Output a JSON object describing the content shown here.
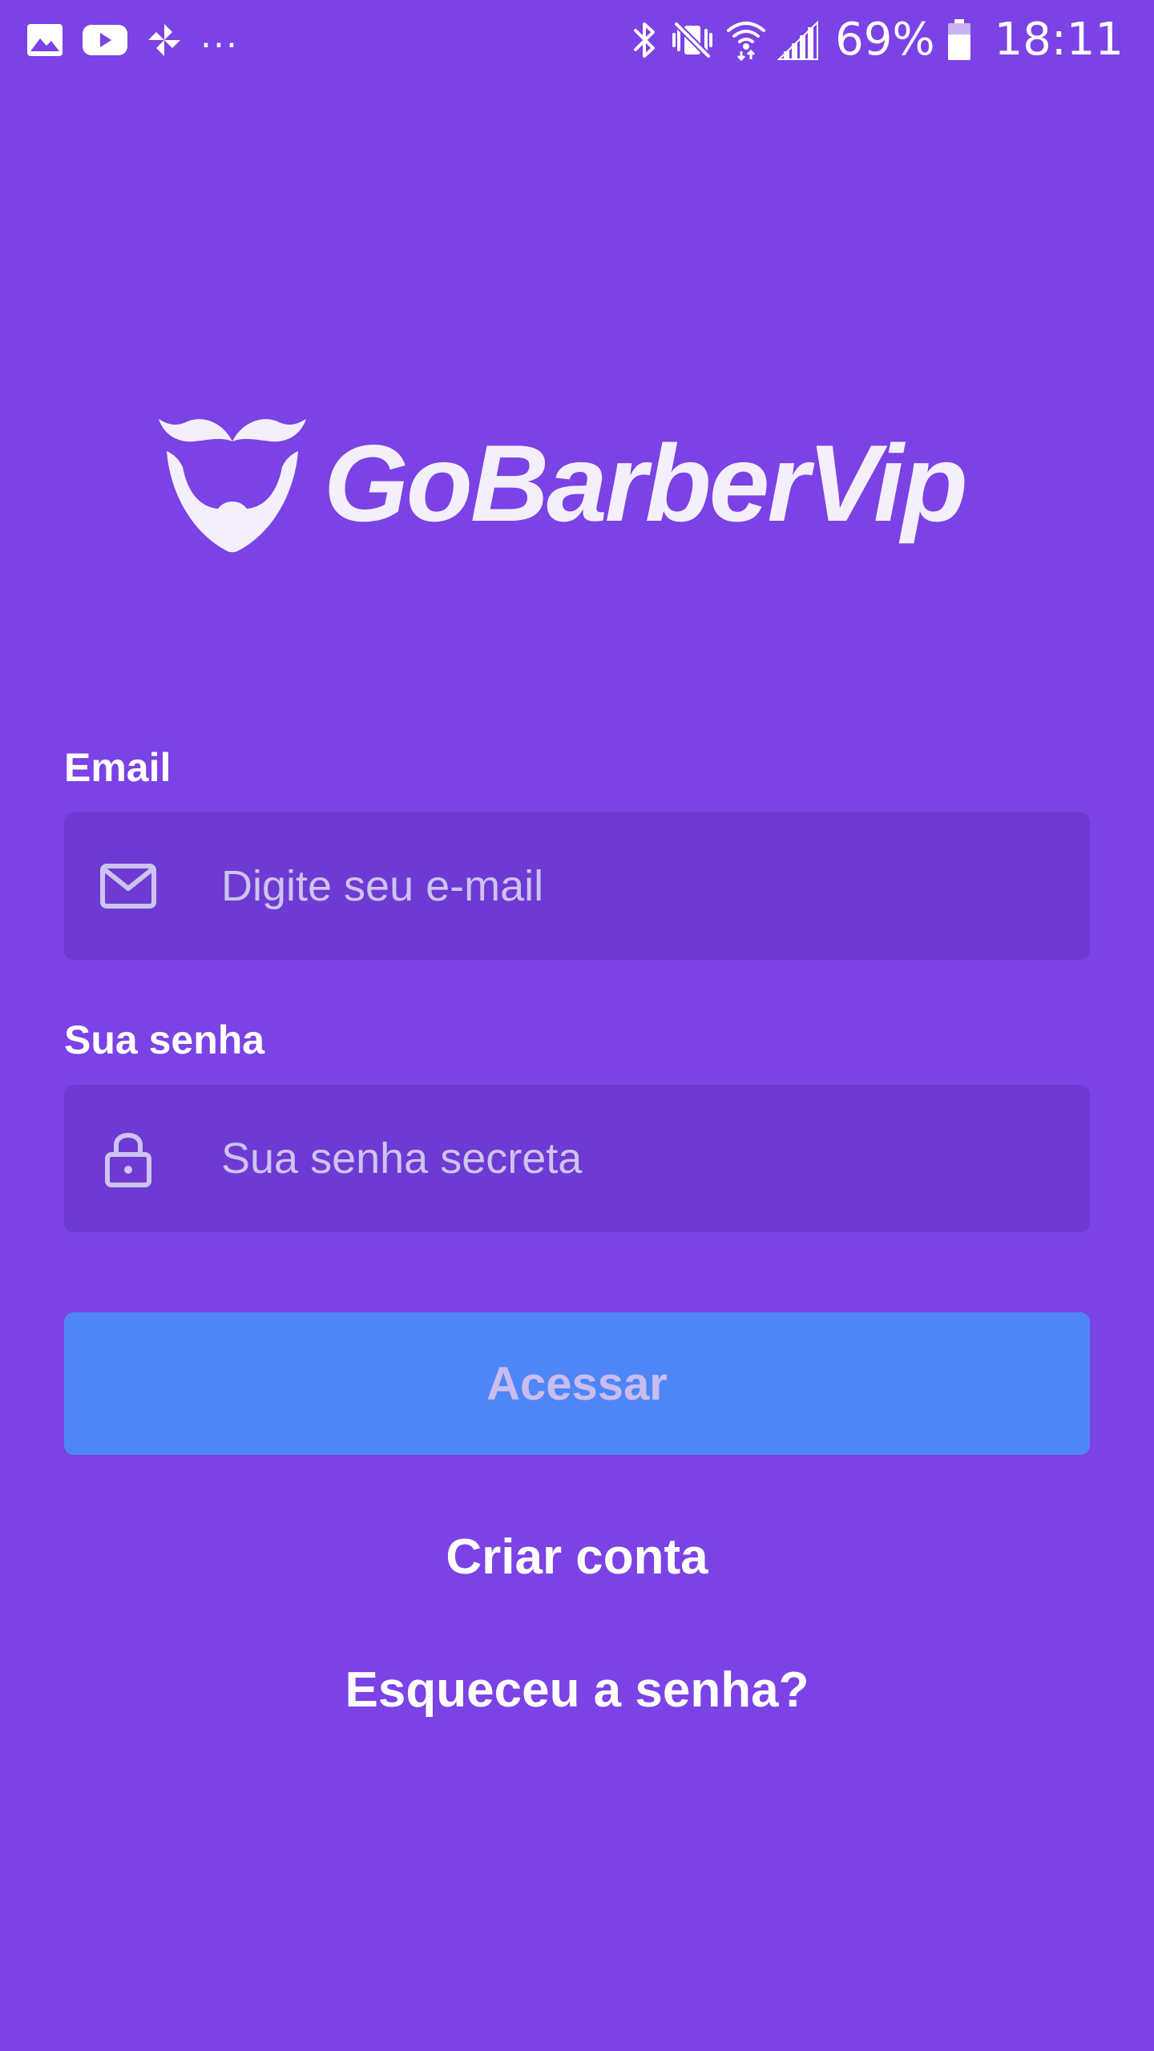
{
  "status_bar": {
    "left_icons": [
      "gallery-icon",
      "youtube-icon",
      "pinwheel-icon"
    ],
    "more_indicator": "...",
    "right_icons": [
      "bluetooth-icon",
      "vibrate-mute-icon",
      "wifi-icon",
      "signal-icon",
      "battery-icon"
    ],
    "battery_percent": "69%",
    "time": "18:11"
  },
  "logo": {
    "icon": "barber-mustache-beard-icon",
    "text": "GoBarberVip"
  },
  "login_form": {
    "email": {
      "label": "Email",
      "placeholder": "Digite seu e-mail",
      "value": "",
      "icon": "mail-icon"
    },
    "password": {
      "label": "Sua senha",
      "placeholder": "Sua senha secreta",
      "value": "",
      "icon": "lock-icon"
    },
    "submit_label": "Acessar"
  },
  "links": {
    "create_account": "Criar conta",
    "forgot_password": "Esqueceu a senha?"
  },
  "colors": {
    "background": "#7b42e6",
    "input_background": "#6d3ad4",
    "button_background": "#4f86f7",
    "button_text": "#c9bdf0",
    "placeholder_text": "#cfc3ef",
    "text": "#ffffff"
  }
}
